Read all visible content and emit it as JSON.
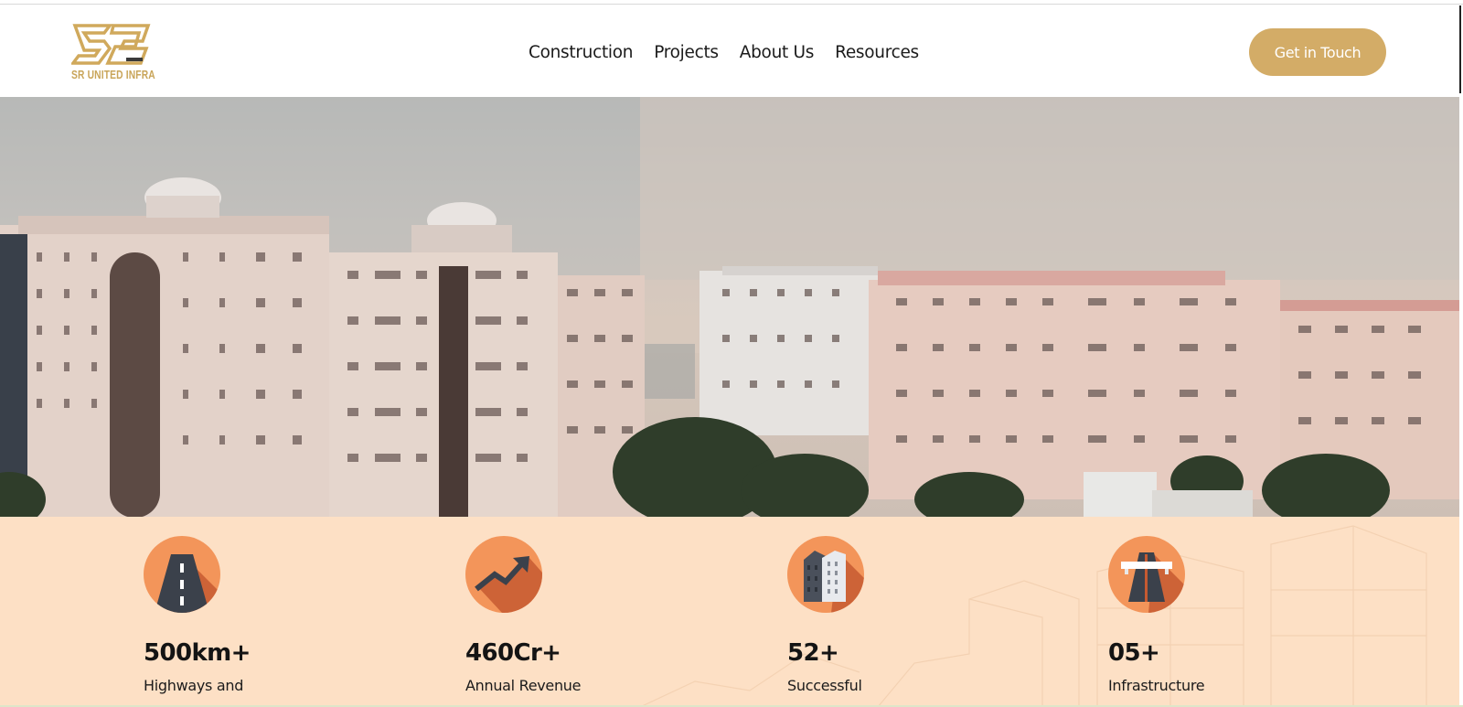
{
  "brand": {
    "name": "SR UNITED INFRA",
    "accent": "#d3ac67"
  },
  "nav": {
    "items": [
      {
        "label": "Construction"
      },
      {
        "label": "Projects"
      },
      {
        "label": "About Us"
      },
      {
        "label": "Resources"
      }
    ],
    "cta_label": "Get in Touch"
  },
  "hero": {
    "image": "aerial-apartment-towers"
  },
  "stats": {
    "background": "#fde0c5",
    "icon_color": "#f3955a",
    "items": [
      {
        "icon": "road-icon",
        "value": "500km+",
        "label": "Highways and"
      },
      {
        "icon": "trend-up-icon",
        "value": "460Cr+",
        "label": "Annual Revenue"
      },
      {
        "icon": "buildings-icon",
        "value": "52+",
        "label": "Successful"
      },
      {
        "icon": "highway-bridge-icon",
        "value": "05+",
        "label": "Infrastructure"
      }
    ]
  }
}
